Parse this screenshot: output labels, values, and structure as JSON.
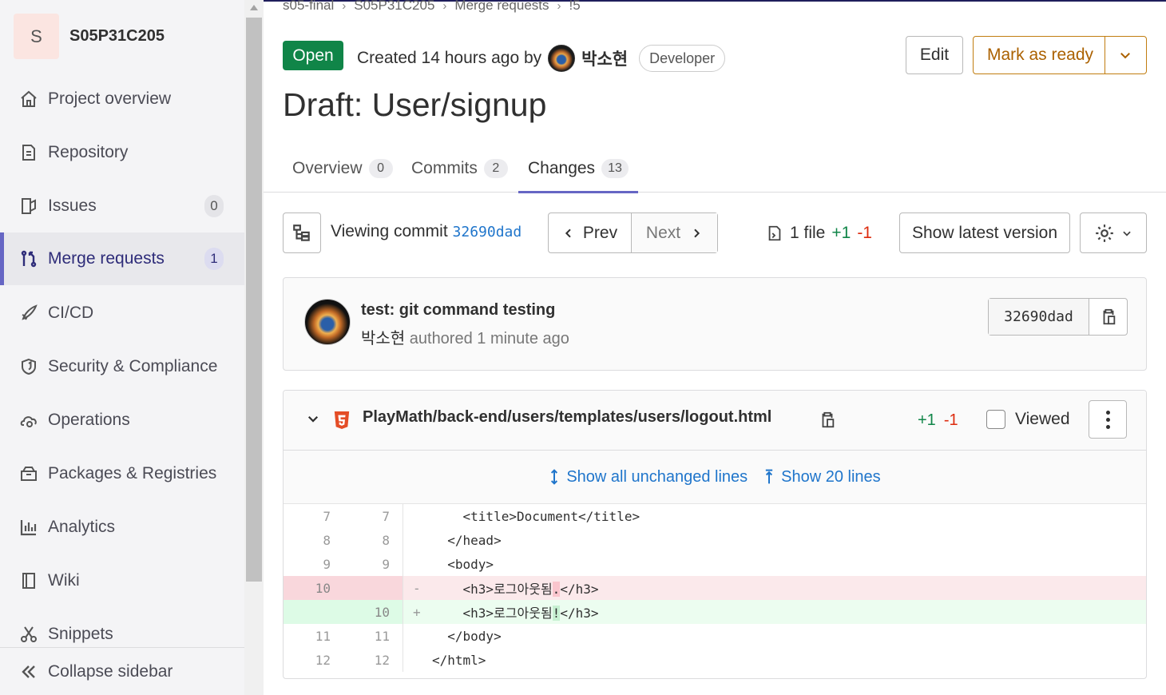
{
  "sidebar": {
    "project_initial": "S",
    "project_name": "S05P31C205",
    "items": [
      {
        "label": "Project overview",
        "icon": "home-icon"
      },
      {
        "label": "Repository",
        "icon": "repository-icon"
      },
      {
        "label": "Issues",
        "icon": "issues-icon",
        "count": "0"
      },
      {
        "label": "Merge requests",
        "icon": "merge-request-icon",
        "count": "1",
        "active": true
      },
      {
        "label": "CI/CD",
        "icon": "rocket-icon"
      },
      {
        "label": "Security & Compliance",
        "icon": "shield-icon"
      },
      {
        "label": "Operations",
        "icon": "cloud-gear-icon"
      },
      {
        "label": "Packages & Registries",
        "icon": "package-icon"
      },
      {
        "label": "Analytics",
        "icon": "chart-icon"
      },
      {
        "label": "Wiki",
        "icon": "book-icon"
      },
      {
        "label": "Snippets",
        "icon": "scissors-icon"
      }
    ],
    "collapse_label": "Collapse sidebar"
  },
  "breadcrumb": [
    "s05-final",
    "S05P31C205",
    "Merge requests",
    "!5"
  ],
  "header": {
    "status": "Open",
    "created_text": "Created 14 hours ago by",
    "author": "박소현",
    "role": "Developer",
    "edit_label": "Edit",
    "mark_ready_label": "Mark as ready",
    "title": "Draft: User/signup"
  },
  "tabs": [
    {
      "label": "Overview",
      "count": "0"
    },
    {
      "label": "Commits",
      "count": "2"
    },
    {
      "label": "Changes",
      "count": "13",
      "active": true
    }
  ],
  "commit_bar": {
    "viewing_label": "Viewing commit",
    "sha": "32690dad",
    "prev_label": "Prev",
    "next_label": "Next",
    "file_count": "1 file",
    "additions": "+1",
    "deletions": "-1",
    "latest_label": "Show latest version"
  },
  "commit": {
    "message": "test: git command testing",
    "author": "박소현",
    "meta": " authored 1 minute ago",
    "sha": "32690dad"
  },
  "diff": {
    "path": "PlayMath/back-end/users/templates/users/logout.html",
    "additions": "+1",
    "deletions": "-1",
    "viewed_label": "Viewed",
    "show_all_label": "Show all unchanged lines",
    "show_20_label": "Show 20 lines",
    "lines": [
      {
        "old": "7",
        "new": "7",
        "sign": "",
        "type": "ctx",
        "code": "    <title>Document</title>"
      },
      {
        "old": "8",
        "new": "8",
        "sign": "",
        "type": "ctx",
        "code": "  </head>"
      },
      {
        "old": "9",
        "new": "9",
        "sign": "",
        "type": "ctx",
        "code": "  <body>"
      },
      {
        "old": "10",
        "new": "",
        "sign": "-",
        "type": "old",
        "pre": "    <h3>로그아웃됨",
        "hl": ".",
        "post": "</h3>"
      },
      {
        "old": "",
        "new": "10",
        "sign": "+",
        "type": "new",
        "pre": "    <h3>로그아웃됨",
        "hl": "!",
        "post": "</h3>"
      },
      {
        "old": "11",
        "new": "11",
        "sign": "",
        "type": "ctx",
        "code": "  </body>"
      },
      {
        "old": "12",
        "new": "12",
        "sign": "",
        "type": "ctx",
        "code": "</html>"
      }
    ]
  },
  "colors": {
    "open_badge": "#108548",
    "ready_border": "#c17d10",
    "link": "#1f75cb",
    "active_nav": "#6666c4"
  }
}
